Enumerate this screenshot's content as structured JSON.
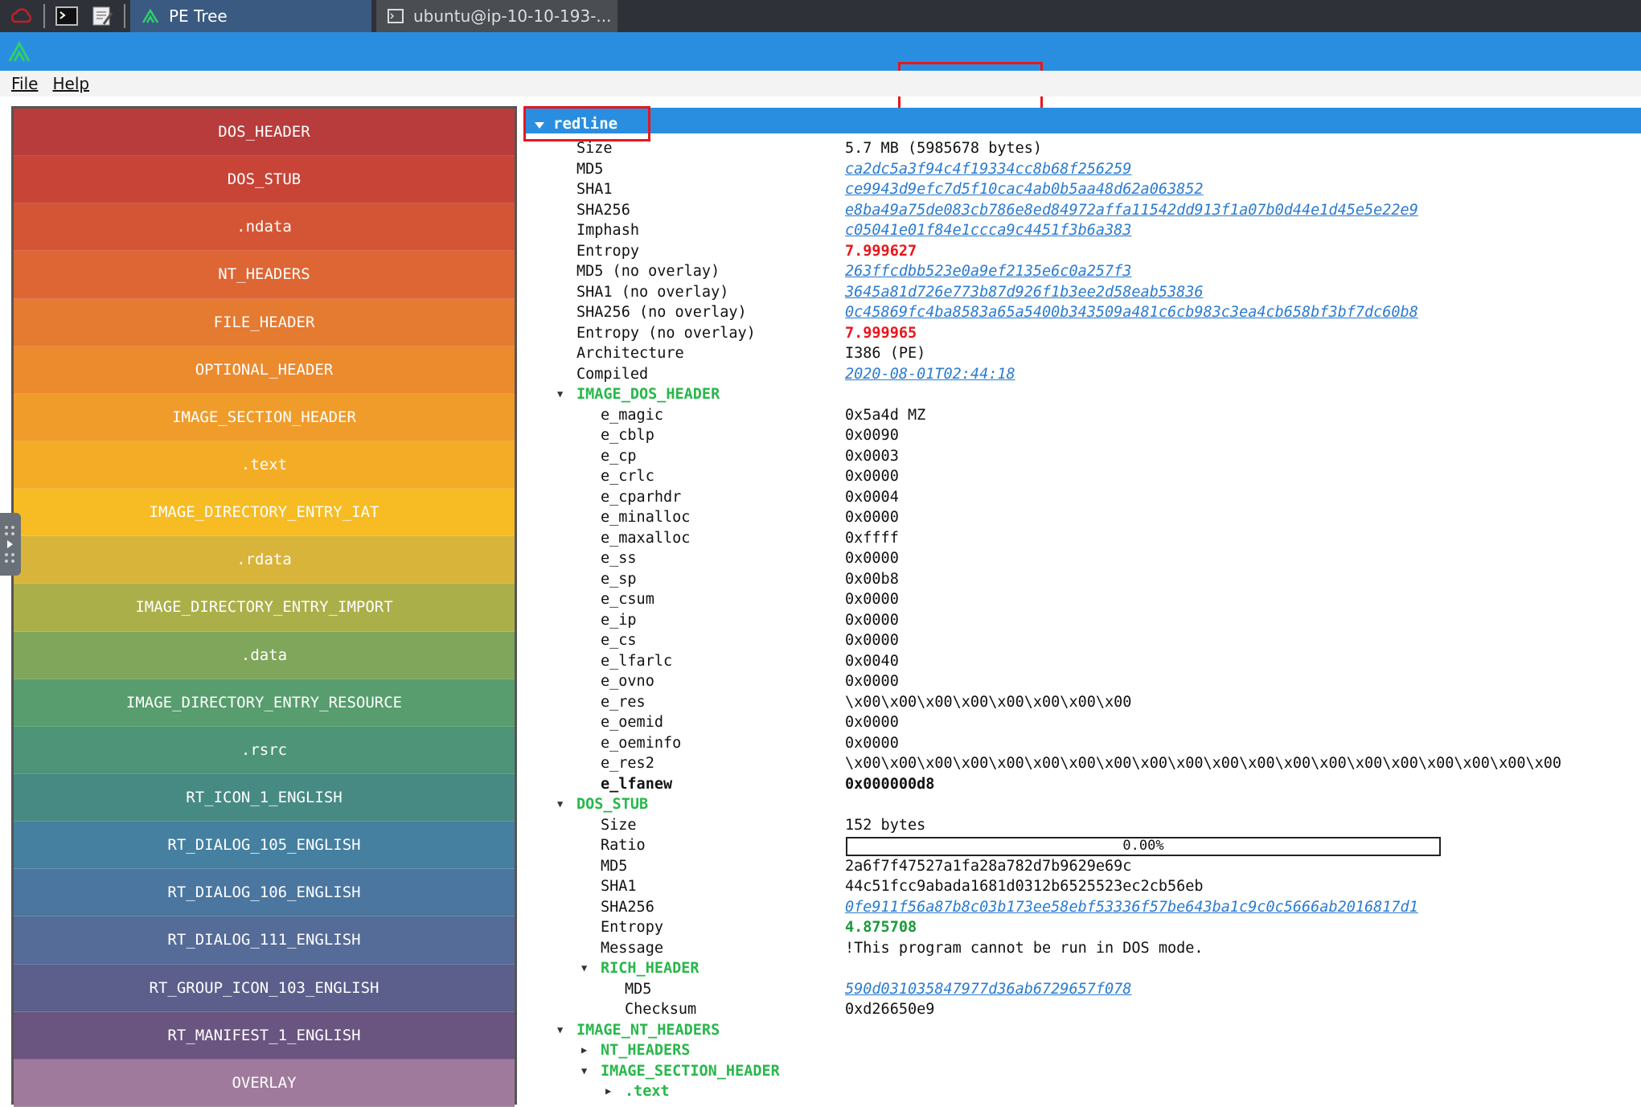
{
  "taskbar": {
    "tasks": [
      {
        "label": "PE Tree",
        "active": true
      },
      {
        "label": "ubuntu@ip-10-10-193-...",
        "active": false
      }
    ]
  },
  "window": {
    "title": "PE Tree"
  },
  "menu": {
    "file": "File",
    "help": "Help"
  },
  "sections": [
    {
      "name": "DOS_HEADER",
      "color": "#b83c3c"
    },
    {
      "name": "DOS_STUB",
      "color": "#c74437"
    },
    {
      "name": ".ndata",
      "color": "#d45535"
    },
    {
      "name": "NT_HEADERS",
      "color": "#dd6634"
    },
    {
      "name": "FILE_HEADER",
      "color": "#e57a31"
    },
    {
      "name": "OPTIONAL_HEADER",
      "color": "#ec8a2e"
    },
    {
      "name": "IMAGE_SECTION_HEADER",
      "color": "#f09c2b"
    },
    {
      "name": ".text",
      "color": "#f4ac27"
    },
    {
      "name": "IMAGE_DIRECTORY_ENTRY_IAT",
      "color": "#f7bc24"
    },
    {
      "name": ".rdata",
      "color": "#d8b43a"
    },
    {
      "name": "IMAGE_DIRECTORY_ENTRY_IMPORT",
      "color": "#abaf4a"
    },
    {
      "name": ".data",
      "color": "#7fa65b"
    },
    {
      "name": "IMAGE_DIRECTORY_ENTRY_RESOURCE",
      "color": "#579d6d"
    },
    {
      "name": ".rsrc",
      "color": "#4d9478"
    },
    {
      "name": "RT_ICON_1_ENGLISH",
      "color": "#478a84"
    },
    {
      "name": "RT_DIALOG_105_ENGLISH",
      "color": "#4580a0"
    },
    {
      "name": "RT_DIALOG_106_ENGLISH",
      "color": "#4a76a0"
    },
    {
      "name": "RT_DIALOG_111_ENGLISH",
      "color": "#566c98"
    },
    {
      "name": "RT_GROUP_ICON_103_ENGLISH",
      "color": "#5c5f8c"
    },
    {
      "name": "RT_MANIFEST_1_ENGLISH",
      "color": "#6a5480"
    },
    {
      "name": "OVERLAY",
      "color": "#a07a9c"
    }
  ],
  "tree": {
    "root": "redline",
    "rows": [
      {
        "key": "Size",
        "value": "5.7 MB (5985678 bytes)",
        "indent": 1,
        "style": "plain"
      },
      {
        "key": "MD5",
        "value": "ca2dc5a3f94c4f19334cc8b68f256259",
        "indent": 1,
        "style": "link"
      },
      {
        "key": "SHA1",
        "value": "ce9943d9efc7d5f10cac4ab0b5aa48d62a063852",
        "indent": 1,
        "style": "link"
      },
      {
        "key": "SHA256",
        "value": "e8ba49a75de083cb786e8ed84972affa11542dd913f1a07b0d44e1d45e5e22e9",
        "indent": 1,
        "style": "link"
      },
      {
        "key": "Imphash",
        "value": "c05041e01f84e1ccca9c4451f3b6a383",
        "indent": 1,
        "style": "link"
      },
      {
        "key": "Entropy",
        "value": "7.999627",
        "indent": 1,
        "style": "red"
      },
      {
        "key": "MD5 (no overlay)",
        "value": "263ffcdbb523e0a9ef2135e6c0a257f3",
        "indent": 1,
        "style": "link"
      },
      {
        "key": "SHA1 (no overlay)",
        "value": "3645a81d726e773b87d926f1b3ee2d58eab53836",
        "indent": 1,
        "style": "link"
      },
      {
        "key": "SHA256 (no overlay)",
        "value": "0c45869fc4ba8583a65a5400b343509a481c6cb983c3ea4cb658bf3bf7dc60b8",
        "indent": 1,
        "style": "link"
      },
      {
        "key": "Entropy (no overlay)",
        "value": "7.999965",
        "indent": 1,
        "style": "red"
      },
      {
        "key": "Architecture",
        "value": "I386 (PE)",
        "indent": 1,
        "style": "plain"
      },
      {
        "key": "Compiled",
        "value": "2020-08-01T02:44:18",
        "indent": 1,
        "style": "link"
      },
      {
        "key": "IMAGE_DOS_HEADER",
        "value": "",
        "indent": 1,
        "style": "section",
        "arrow": "down"
      },
      {
        "key": "e_magic",
        "value": "0x5a4d MZ",
        "indent": 2,
        "style": "plain"
      },
      {
        "key": "e_cblp",
        "value": "0x0090",
        "indent": 2,
        "style": "plain"
      },
      {
        "key": "e_cp",
        "value": "0x0003",
        "indent": 2,
        "style": "plain"
      },
      {
        "key": "e_crlc",
        "value": "0x0000",
        "indent": 2,
        "style": "plain"
      },
      {
        "key": "e_cparhdr",
        "value": "0x0004",
        "indent": 2,
        "style": "plain"
      },
      {
        "key": "e_minalloc",
        "value": "0x0000",
        "indent": 2,
        "style": "plain"
      },
      {
        "key": "e_maxalloc",
        "value": "0xffff",
        "indent": 2,
        "style": "plain"
      },
      {
        "key": "e_ss",
        "value": "0x0000",
        "indent": 2,
        "style": "plain"
      },
      {
        "key": "e_sp",
        "value": "0x00b8",
        "indent": 2,
        "style": "plain"
      },
      {
        "key": "e_csum",
        "value": "0x0000",
        "indent": 2,
        "style": "plain"
      },
      {
        "key": "e_ip",
        "value": "0x0000",
        "indent": 2,
        "style": "plain"
      },
      {
        "key": "e_cs",
        "value": "0x0000",
        "indent": 2,
        "style": "plain"
      },
      {
        "key": "e_lfarlc",
        "value": "0x0040",
        "indent": 2,
        "style": "plain"
      },
      {
        "key": "e_ovno",
        "value": "0x0000",
        "indent": 2,
        "style": "plain"
      },
      {
        "key": "e_res",
        "value": "\\x00\\x00\\x00\\x00\\x00\\x00\\x00\\x00",
        "indent": 2,
        "style": "plain"
      },
      {
        "key": "e_oemid",
        "value": "0x0000",
        "indent": 2,
        "style": "plain"
      },
      {
        "key": "e_oeminfo",
        "value": "0x0000",
        "indent": 2,
        "style": "plain"
      },
      {
        "key": "e_res2",
        "value": "\\x00\\x00\\x00\\x00\\x00\\x00\\x00\\x00\\x00\\x00\\x00\\x00\\x00\\x00\\x00\\x00\\x00\\x00\\x00\\x00",
        "indent": 2,
        "style": "plain"
      },
      {
        "key": "e_lfanew",
        "value": "0x000000d8",
        "indent": 2,
        "style": "bold"
      },
      {
        "key": "DOS_STUB",
        "value": "",
        "indent": 1,
        "style": "section",
        "arrow": "down"
      },
      {
        "key": "Size",
        "value": "152 bytes",
        "indent": 2,
        "style": "plain"
      },
      {
        "key": "Ratio",
        "value": "0.00%",
        "indent": 2,
        "style": "bar"
      },
      {
        "key": "MD5",
        "value": "2a6f7f47527a1fa28a782d7b9629e69c",
        "indent": 2,
        "style": "plain"
      },
      {
        "key": "SHA1",
        "value": "44c51fcc9abada1681d0312b6525523ec2cb56eb",
        "indent": 2,
        "style": "plain"
      },
      {
        "key": "SHA256",
        "value": "0fe911f56a87b8c03b173ee58ebf53336f57be643ba1c9c0c5666ab2016817d1",
        "indent": 2,
        "style": "link"
      },
      {
        "key": "Entropy",
        "value": "4.875708",
        "indent": 2,
        "style": "green"
      },
      {
        "key": "Message",
        "value": "!This program cannot be run in DOS mode.",
        "indent": 2,
        "style": "plain"
      },
      {
        "key": "RICH_HEADER",
        "value": "",
        "indent": 2,
        "style": "section",
        "arrow": "down"
      },
      {
        "key": "MD5",
        "value": "590d031035847977d36ab6729657f078",
        "indent": 3,
        "style": "link"
      },
      {
        "key": "Checksum",
        "value": "0xd26650e9",
        "indent": 3,
        "style": "plain"
      },
      {
        "key": "IMAGE_NT_HEADERS",
        "value": "",
        "indent": 1,
        "style": "section",
        "arrow": "down"
      },
      {
        "key": "NT_HEADERS",
        "value": "",
        "indent": 2,
        "style": "section",
        "arrow": "right"
      },
      {
        "key": "IMAGE_SECTION_HEADER",
        "value": "",
        "indent": 2,
        "style": "section",
        "arrow": "down"
      },
      {
        "key": ".text",
        "value": "",
        "indent": 3,
        "style": "section",
        "arrow": "right"
      }
    ]
  }
}
